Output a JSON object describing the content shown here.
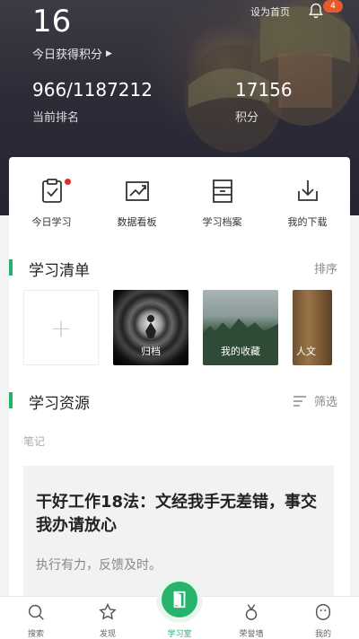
{
  "header": {
    "today_points": "16",
    "today_points_label": "今日获得积分",
    "rank_value": "966/1187212",
    "rank_label": "当前排名",
    "total_points": "17156",
    "total_points_label": "积分",
    "set_home": "设为首页",
    "notification_count": "4"
  },
  "quick_actions": [
    {
      "label": "今日学习",
      "icon": "clipboard-check-icon",
      "has_dot": true
    },
    {
      "label": "数据看板",
      "icon": "chart-trend-icon"
    },
    {
      "label": "学习档案",
      "icon": "archive-box-icon"
    },
    {
      "label": "我的下载",
      "icon": "download-icon"
    }
  ],
  "study_list": {
    "title": "学习清单",
    "sort_label": "排序",
    "items": [
      "归档",
      "我的收藏",
      "人文"
    ]
  },
  "resources": {
    "title": "学习资源",
    "filter_label": "筛选",
    "category": "笔记",
    "article_title": "干好工作18法：文经我手无差错，事交我办请放心",
    "article_summary": "执行有力，反馈及时。"
  },
  "tabbar": [
    {
      "label": "搜索",
      "icon": "search-icon"
    },
    {
      "label": "发现",
      "icon": "star-icon"
    },
    {
      "label": "学习室",
      "icon": "door-icon",
      "active": true
    },
    {
      "label": "荣誉墙",
      "icon": "medal-icon"
    },
    {
      "label": "我的",
      "icon": "profile-icon"
    }
  ],
  "colors": {
    "accent": "#24b26b",
    "badge": "#e65a2e",
    "dot": "#e52a2a"
  }
}
